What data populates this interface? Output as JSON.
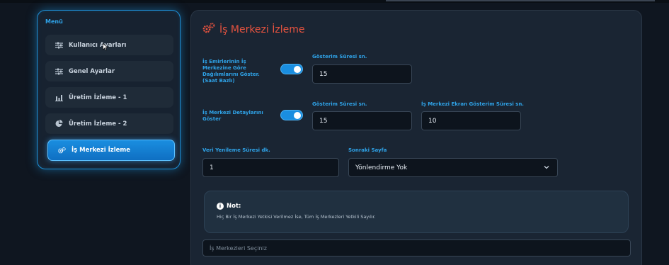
{
  "sidebar": {
    "title": "Menü",
    "items": [
      {
        "label": "Kullanıcı Ayarları",
        "icon": "sliders-icon"
      },
      {
        "label": "Genel Ayarlar",
        "icon": "sliders-icon"
      },
      {
        "label": "Üretim İzleme - 1",
        "icon": "bar-chart-icon"
      },
      {
        "label": "Üretim İzleme - 2",
        "icon": "pie-chart-icon"
      },
      {
        "label": "İş Merkezi İzleme",
        "icon": "gears-icon",
        "active": true
      }
    ]
  },
  "main": {
    "title": "İş Merkezi İzleme",
    "row1": {
      "toggle_label": "İş Emirlerinin İş Merkezine Göre Dağılımlarını Göster. (Saat Bazlı)",
      "toggle_on": true,
      "duration_label": "Gösterim Süresi sn.",
      "duration_value": "15"
    },
    "row2": {
      "toggle_label": "İş Merkezi Detaylarını Göster",
      "toggle_on": true,
      "duration_label": "Gösterim Süresi sn.",
      "duration_value": "15",
      "screen_label": "İş Merkezi Ekran Gösterim Süresi sn.",
      "screen_value": "10"
    },
    "row3": {
      "refresh_label": "Veri Yenileme Süresi dk.",
      "refresh_value": "1",
      "next_label": "Sonraki Sayfa",
      "next_value": "Yönlendirme Yok"
    },
    "note": {
      "title": "Not:",
      "text": "Hiç Bir İş Merkezi Yetkisi Verilmez İse, Tüm İş Merkezleri Yetkili Sayılır."
    },
    "workcenter_select": {
      "placeholder": "İş Merkezleri Seçiniz"
    }
  },
  "colors": {
    "accent": "#1a8ee0",
    "label_blue": "#2fa3e8",
    "title_red": "#e8533f",
    "background": "#0f1620"
  }
}
